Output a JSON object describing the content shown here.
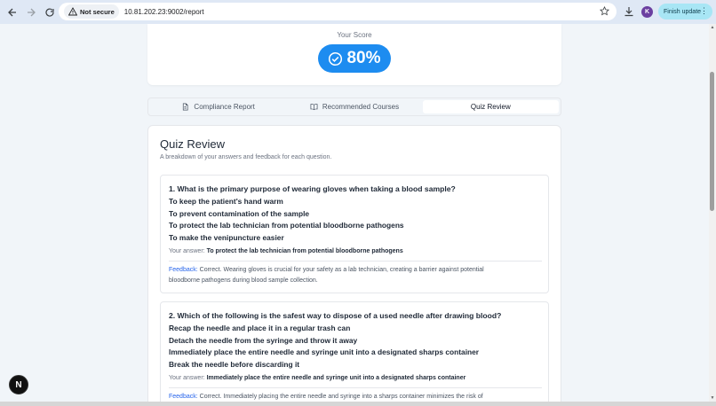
{
  "browser": {
    "security_label": "Not secure",
    "url": "10.81.202.23:9002/report",
    "profile_initial": "K",
    "update_button_label": "Finish update"
  },
  "score": {
    "label": "Your Score",
    "value": "80%"
  },
  "tabs": [
    {
      "label": "Compliance Report",
      "icon": "document-icon",
      "active": false
    },
    {
      "label": "Recommended Courses",
      "icon": "book-open-icon",
      "active": false
    },
    {
      "label": "Quiz Review",
      "icon": "",
      "active": true
    }
  ],
  "quiz_review": {
    "title": "Quiz Review",
    "subtitle": "A breakdown of your answers and feedback for each question.",
    "questions": [
      {
        "text": "1. What is the primary purpose of wearing gloves when taking a blood sample?",
        "options": [
          "To keep the patient's hand warm",
          "To prevent contamination of the sample",
          "To protect the lab technician from potential bloodborne pathogens",
          "To make the venipuncture easier"
        ],
        "answer_label": "Your answer:",
        "answer": "To protect the lab technician from potential bloodborne pathogens",
        "feedback_label": "Feedback:",
        "feedback_line1": "Correct. Wearing gloves is crucial for your safety as a lab technician, creating a barrier against potential",
        "feedback_line2": "bloodborne pathogens during blood sample collection."
      },
      {
        "text": "2. Which of the following is the safest way to dispose of a used needle after drawing blood?",
        "options": [
          "Recap the needle and place it in a regular trash can",
          "Detach the needle from the syringe and throw it away",
          "Immediately place the entire needle and syringe unit into a designated sharps container",
          "Break the needle before discarding it"
        ],
        "answer_label": "Your answer:",
        "answer": "Immediately place the entire needle and syringe unit into a designated sharps container",
        "feedback_label": "Feedback:",
        "feedback_line1": "Correct. Immediately placing the entire needle and syringe into a sharps container minimizes the risk of",
        "feedback_line2": ""
      }
    ]
  },
  "floating_badge": "N",
  "colors": {
    "accent": "#1d8cf0",
    "feedback_label": "#2563eb",
    "chrome": "#dfe8f5"
  }
}
